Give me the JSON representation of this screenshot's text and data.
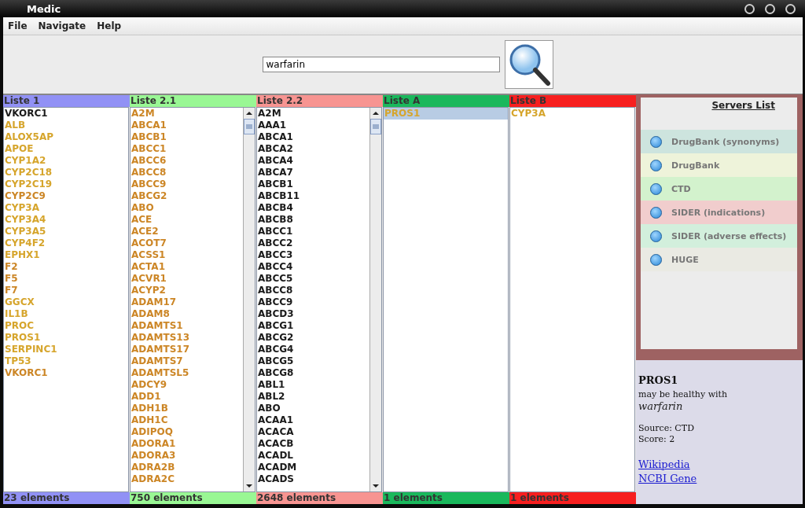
{
  "window": {
    "title": "Medic"
  },
  "menu": [
    "File",
    "Navigate",
    "Help"
  ],
  "search": {
    "value": "warfarin"
  },
  "lists": [
    {
      "title": "Liste 1",
      "color": "#9191f5",
      "scrollbar": false,
      "footer": "23 elements",
      "items": [
        {
          "text": "VKORC1",
          "color": "#1a1a1a",
          "selected": false
        },
        {
          "text": "ALB",
          "color": "#d6a52c",
          "selected": false
        },
        {
          "text": "ALOX5AP",
          "color": "#d6a52c",
          "selected": false
        },
        {
          "text": "APOE",
          "color": "#d6a52c",
          "selected": false
        },
        {
          "text": "CYP1A2",
          "color": "#d6a52c",
          "selected": false
        },
        {
          "text": "CYP2C18",
          "color": "#d6a52c",
          "selected": false
        },
        {
          "text": "CYP2C19",
          "color": "#d6a52c",
          "selected": false
        },
        {
          "text": "CYP2C9",
          "color": "#cc8626",
          "selected": false
        },
        {
          "text": "CYP3A",
          "color": "#d6a52c",
          "selected": false
        },
        {
          "text": "CYP3A4",
          "color": "#d6a52c",
          "selected": false
        },
        {
          "text": "CYP3A5",
          "color": "#d6a52c",
          "selected": false
        },
        {
          "text": "CYP4F2",
          "color": "#d6a52c",
          "selected": false
        },
        {
          "text": "EPHX1",
          "color": "#d6a52c",
          "selected": false
        },
        {
          "text": "F2",
          "color": "#cc8626",
          "selected": false
        },
        {
          "text": "F5",
          "color": "#cc8626",
          "selected": false
        },
        {
          "text": "F7",
          "color": "#cc8626",
          "selected": false
        },
        {
          "text": "GGCX",
          "color": "#d6a52c",
          "selected": false
        },
        {
          "text": "IL1B",
          "color": "#d6a52c",
          "selected": false
        },
        {
          "text": "PROC",
          "color": "#d6a52c",
          "selected": false
        },
        {
          "text": "PROS1",
          "color": "#d6a52c",
          "selected": false
        },
        {
          "text": "SERPINC1",
          "color": "#d6a52c",
          "selected": false
        },
        {
          "text": "TP53",
          "color": "#d6a52c",
          "selected": false
        },
        {
          "text": "VKORC1",
          "color": "#cc8626",
          "selected": false
        }
      ]
    },
    {
      "title": "Liste 2.1",
      "color": "#99f794",
      "scrollbar": true,
      "footer": "750 elements",
      "items": [
        {
          "text": "A2M",
          "color": "#cc8626",
          "selected": false
        },
        {
          "text": "ABCA1",
          "color": "#cc8626",
          "selected": false
        },
        {
          "text": "ABCB1",
          "color": "#cc8626",
          "selected": false
        },
        {
          "text": "ABCC1",
          "color": "#cc8626",
          "selected": false
        },
        {
          "text": "ABCC6",
          "color": "#cc8626",
          "selected": false
        },
        {
          "text": "ABCC8",
          "color": "#cc8626",
          "selected": false
        },
        {
          "text": "ABCC9",
          "color": "#cc8626",
          "selected": false
        },
        {
          "text": "ABCG2",
          "color": "#cc8626",
          "selected": false
        },
        {
          "text": "ABO",
          "color": "#cc8626",
          "selected": false
        },
        {
          "text": "ACE",
          "color": "#cc8626",
          "selected": false
        },
        {
          "text": "ACE2",
          "color": "#cc8626",
          "selected": false
        },
        {
          "text": "ACOT7",
          "color": "#cc8626",
          "selected": false
        },
        {
          "text": "ACSS1",
          "color": "#cc8626",
          "selected": false
        },
        {
          "text": "ACTA1",
          "color": "#cc8626",
          "selected": false
        },
        {
          "text": "ACVR1",
          "color": "#cc8626",
          "selected": false
        },
        {
          "text": "ACYP2",
          "color": "#cc8626",
          "selected": false
        },
        {
          "text": "ADAM17",
          "color": "#cc8626",
          "selected": false
        },
        {
          "text": "ADAM8",
          "color": "#cc8626",
          "selected": false
        },
        {
          "text": "ADAMTS1",
          "color": "#cc8626",
          "selected": false
        },
        {
          "text": "ADAMTS13",
          "color": "#cc8626",
          "selected": false
        },
        {
          "text": "ADAMTS17",
          "color": "#cc8626",
          "selected": false
        },
        {
          "text": "ADAMTS7",
          "color": "#cc8626",
          "selected": false
        },
        {
          "text": "ADAMTSL5",
          "color": "#cc8626",
          "selected": false
        },
        {
          "text": "ADCY9",
          "color": "#cc8626",
          "selected": false
        },
        {
          "text": "ADD1",
          "color": "#cc8626",
          "selected": false
        },
        {
          "text": "ADH1B",
          "color": "#cc8626",
          "selected": false
        },
        {
          "text": "ADH1C",
          "color": "#cc8626",
          "selected": false
        },
        {
          "text": "ADIPOQ",
          "color": "#cc8626",
          "selected": false
        },
        {
          "text": "ADORA1",
          "color": "#cc8626",
          "selected": false
        },
        {
          "text": "ADORA3",
          "color": "#cc8626",
          "selected": false
        },
        {
          "text": "ADRA2B",
          "color": "#cc8626",
          "selected": false
        },
        {
          "text": "ADRA2C",
          "color": "#cc8626",
          "selected": false
        }
      ]
    },
    {
      "title": "Liste 2.2",
      "color": "#f79491",
      "scrollbar": true,
      "footer": "2648 elements",
      "items": [
        {
          "text": "A2M",
          "color": "#1a1a1a",
          "selected": false
        },
        {
          "text": "AAA1",
          "color": "#1a1a1a",
          "selected": false
        },
        {
          "text": "ABCA1",
          "color": "#1a1a1a",
          "selected": false
        },
        {
          "text": "ABCA2",
          "color": "#1a1a1a",
          "selected": false
        },
        {
          "text": "ABCA4",
          "color": "#1a1a1a",
          "selected": false
        },
        {
          "text": "ABCA7",
          "color": "#1a1a1a",
          "selected": false
        },
        {
          "text": "ABCB1",
          "color": "#1a1a1a",
          "selected": false
        },
        {
          "text": "ABCB11",
          "color": "#1a1a1a",
          "selected": false
        },
        {
          "text": "ABCB4",
          "color": "#1a1a1a",
          "selected": false
        },
        {
          "text": "ABCB8",
          "color": "#1a1a1a",
          "selected": false
        },
        {
          "text": "ABCC1",
          "color": "#1a1a1a",
          "selected": false
        },
        {
          "text": "ABCC2",
          "color": "#1a1a1a",
          "selected": false
        },
        {
          "text": "ABCC3",
          "color": "#1a1a1a",
          "selected": false
        },
        {
          "text": "ABCC4",
          "color": "#1a1a1a",
          "selected": false
        },
        {
          "text": "ABCC5",
          "color": "#1a1a1a",
          "selected": false
        },
        {
          "text": "ABCC8",
          "color": "#1a1a1a",
          "selected": false
        },
        {
          "text": "ABCC9",
          "color": "#1a1a1a",
          "selected": false
        },
        {
          "text": "ABCD3",
          "color": "#1a1a1a",
          "selected": false
        },
        {
          "text": "ABCG1",
          "color": "#1a1a1a",
          "selected": false
        },
        {
          "text": "ABCG2",
          "color": "#1a1a1a",
          "selected": false
        },
        {
          "text": "ABCG4",
          "color": "#1a1a1a",
          "selected": false
        },
        {
          "text": "ABCG5",
          "color": "#1a1a1a",
          "selected": false
        },
        {
          "text": "ABCG8",
          "color": "#1a1a1a",
          "selected": false
        },
        {
          "text": "ABL1",
          "color": "#1a1a1a",
          "selected": false
        },
        {
          "text": "ABL2",
          "color": "#1a1a1a",
          "selected": false
        },
        {
          "text": "ABO",
          "color": "#1a1a1a",
          "selected": false
        },
        {
          "text": "ACAA1",
          "color": "#1a1a1a",
          "selected": false
        },
        {
          "text": "ACACA",
          "color": "#1a1a1a",
          "selected": false
        },
        {
          "text": "ACACB",
          "color": "#1a1a1a",
          "selected": false
        },
        {
          "text": "ACADL",
          "color": "#1a1a1a",
          "selected": false
        },
        {
          "text": "ACADM",
          "color": "#1a1a1a",
          "selected": false
        },
        {
          "text": "ACADS",
          "color": "#1a1a1a",
          "selected": false
        }
      ]
    },
    {
      "title": "Liste A",
      "color": "#1ab85c",
      "scrollbar": false,
      "footer": "1 elements",
      "items": [
        {
          "text": "PROS1",
          "color": "#d6a52c",
          "selected": true
        }
      ]
    },
    {
      "title": "Liste B",
      "color": "#f71f1f",
      "scrollbar": false,
      "footer": "1 elements",
      "items": [
        {
          "text": "CYP3A",
          "color": "#d6a52c",
          "selected": false
        }
      ]
    }
  ],
  "servers": {
    "title": "Servers List",
    "items": [
      {
        "label": "DrugBank (synonyms)",
        "color": "#cde4de"
      },
      {
        "label": "DrugBank",
        "color": "#eef3da"
      },
      {
        "label": "CTD",
        "color": "#d3f2cd"
      },
      {
        "label": "SIDER (indications)",
        "color": "#f1cdcd"
      },
      {
        "label": "SIDER (adverse effects)",
        "color": "#d2efdc"
      },
      {
        "label": "HUGE",
        "color": "#eaeae3"
      }
    ]
  },
  "details": {
    "gene": "PROS1",
    "relation": "may be healthy with",
    "drug": "warfarin",
    "source": "Source: CTD",
    "score": "Score: 2",
    "links": [
      "Wikipedia",
      "NCBI Gene"
    ]
  }
}
